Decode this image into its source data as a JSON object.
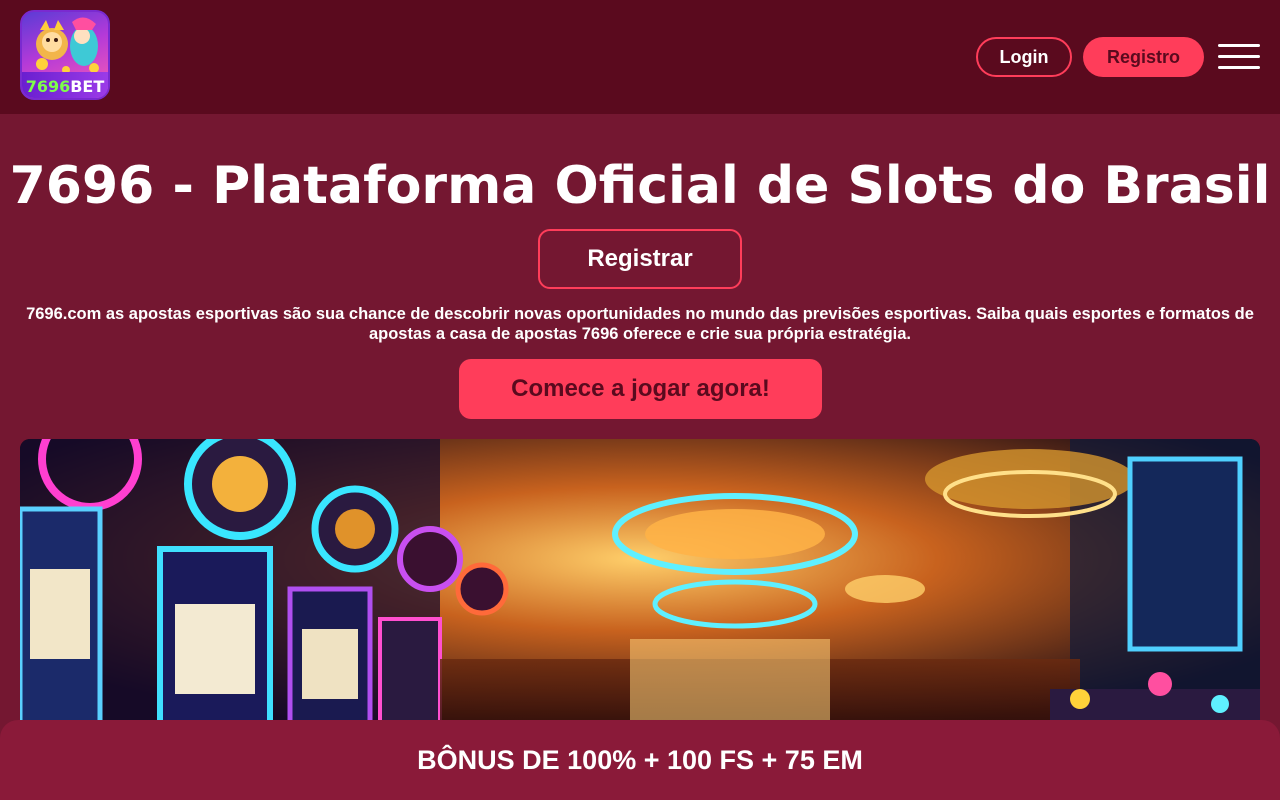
{
  "header": {
    "logo_number": "7696",
    "logo_bet": "BET",
    "login_label": "Login",
    "register_label": "Registro",
    "menu_icon": "hamburger-menu-icon"
  },
  "hero": {
    "title": "7696 - Plataforma Oficial de Slots do Brasil",
    "register_button": "Registrar",
    "description": "7696.com as apostas esportivas são sua chance de descobrir novas oportunidades no mundo das previsões esportivas. Saiba quais esportes e formatos de apostas a casa de apostas 7696 oferece e crie sua própria estratégia.",
    "play_button": "Comece a jogar agora!"
  },
  "bonus": {
    "text": "BÔNUS DE 100% + 100 FS + 75 EM"
  },
  "colors": {
    "page_bg": "#741731",
    "header_bg": "#5a0a1e",
    "accent": "#ff3d5a",
    "bonus_bar": "#8a1a39"
  }
}
